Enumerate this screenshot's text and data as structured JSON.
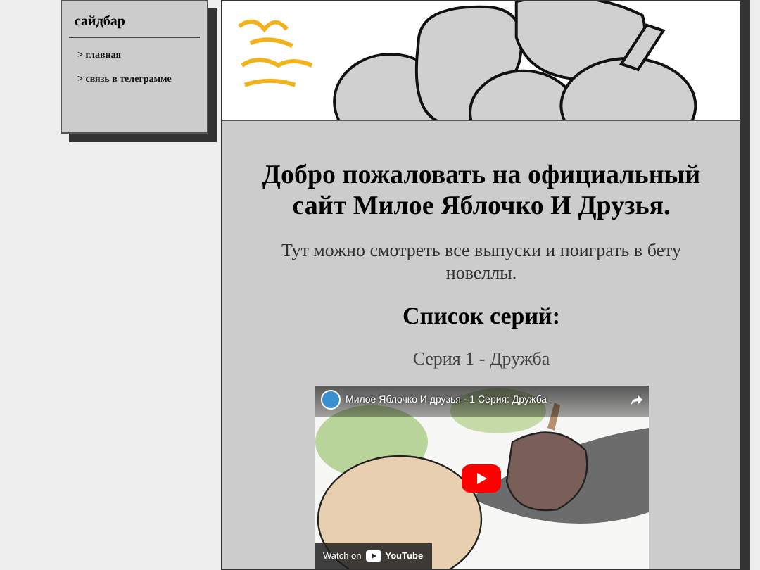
{
  "sidebar": {
    "title": "сайдбар",
    "links": [
      {
        "label": "> главная"
      },
      {
        "label": "> связь в телеграмме"
      }
    ]
  },
  "main": {
    "heading": "Добро пожаловать на официальный сайт Милое Яблочко И Друзья.",
    "intro": "Тут можно смотреть все выпуски и поиграть в бету новеллы.",
    "list_heading": "Список серий:",
    "episodes": [
      {
        "label": "Серия 1 - Дружба",
        "video": {
          "kind": "picture",
          "title": "Милое Яблочко И друзья - 1 Серия: Дружба",
          "watch_label": "Watch on",
          "platform": "YouTube"
        }
      }
    ]
  }
}
